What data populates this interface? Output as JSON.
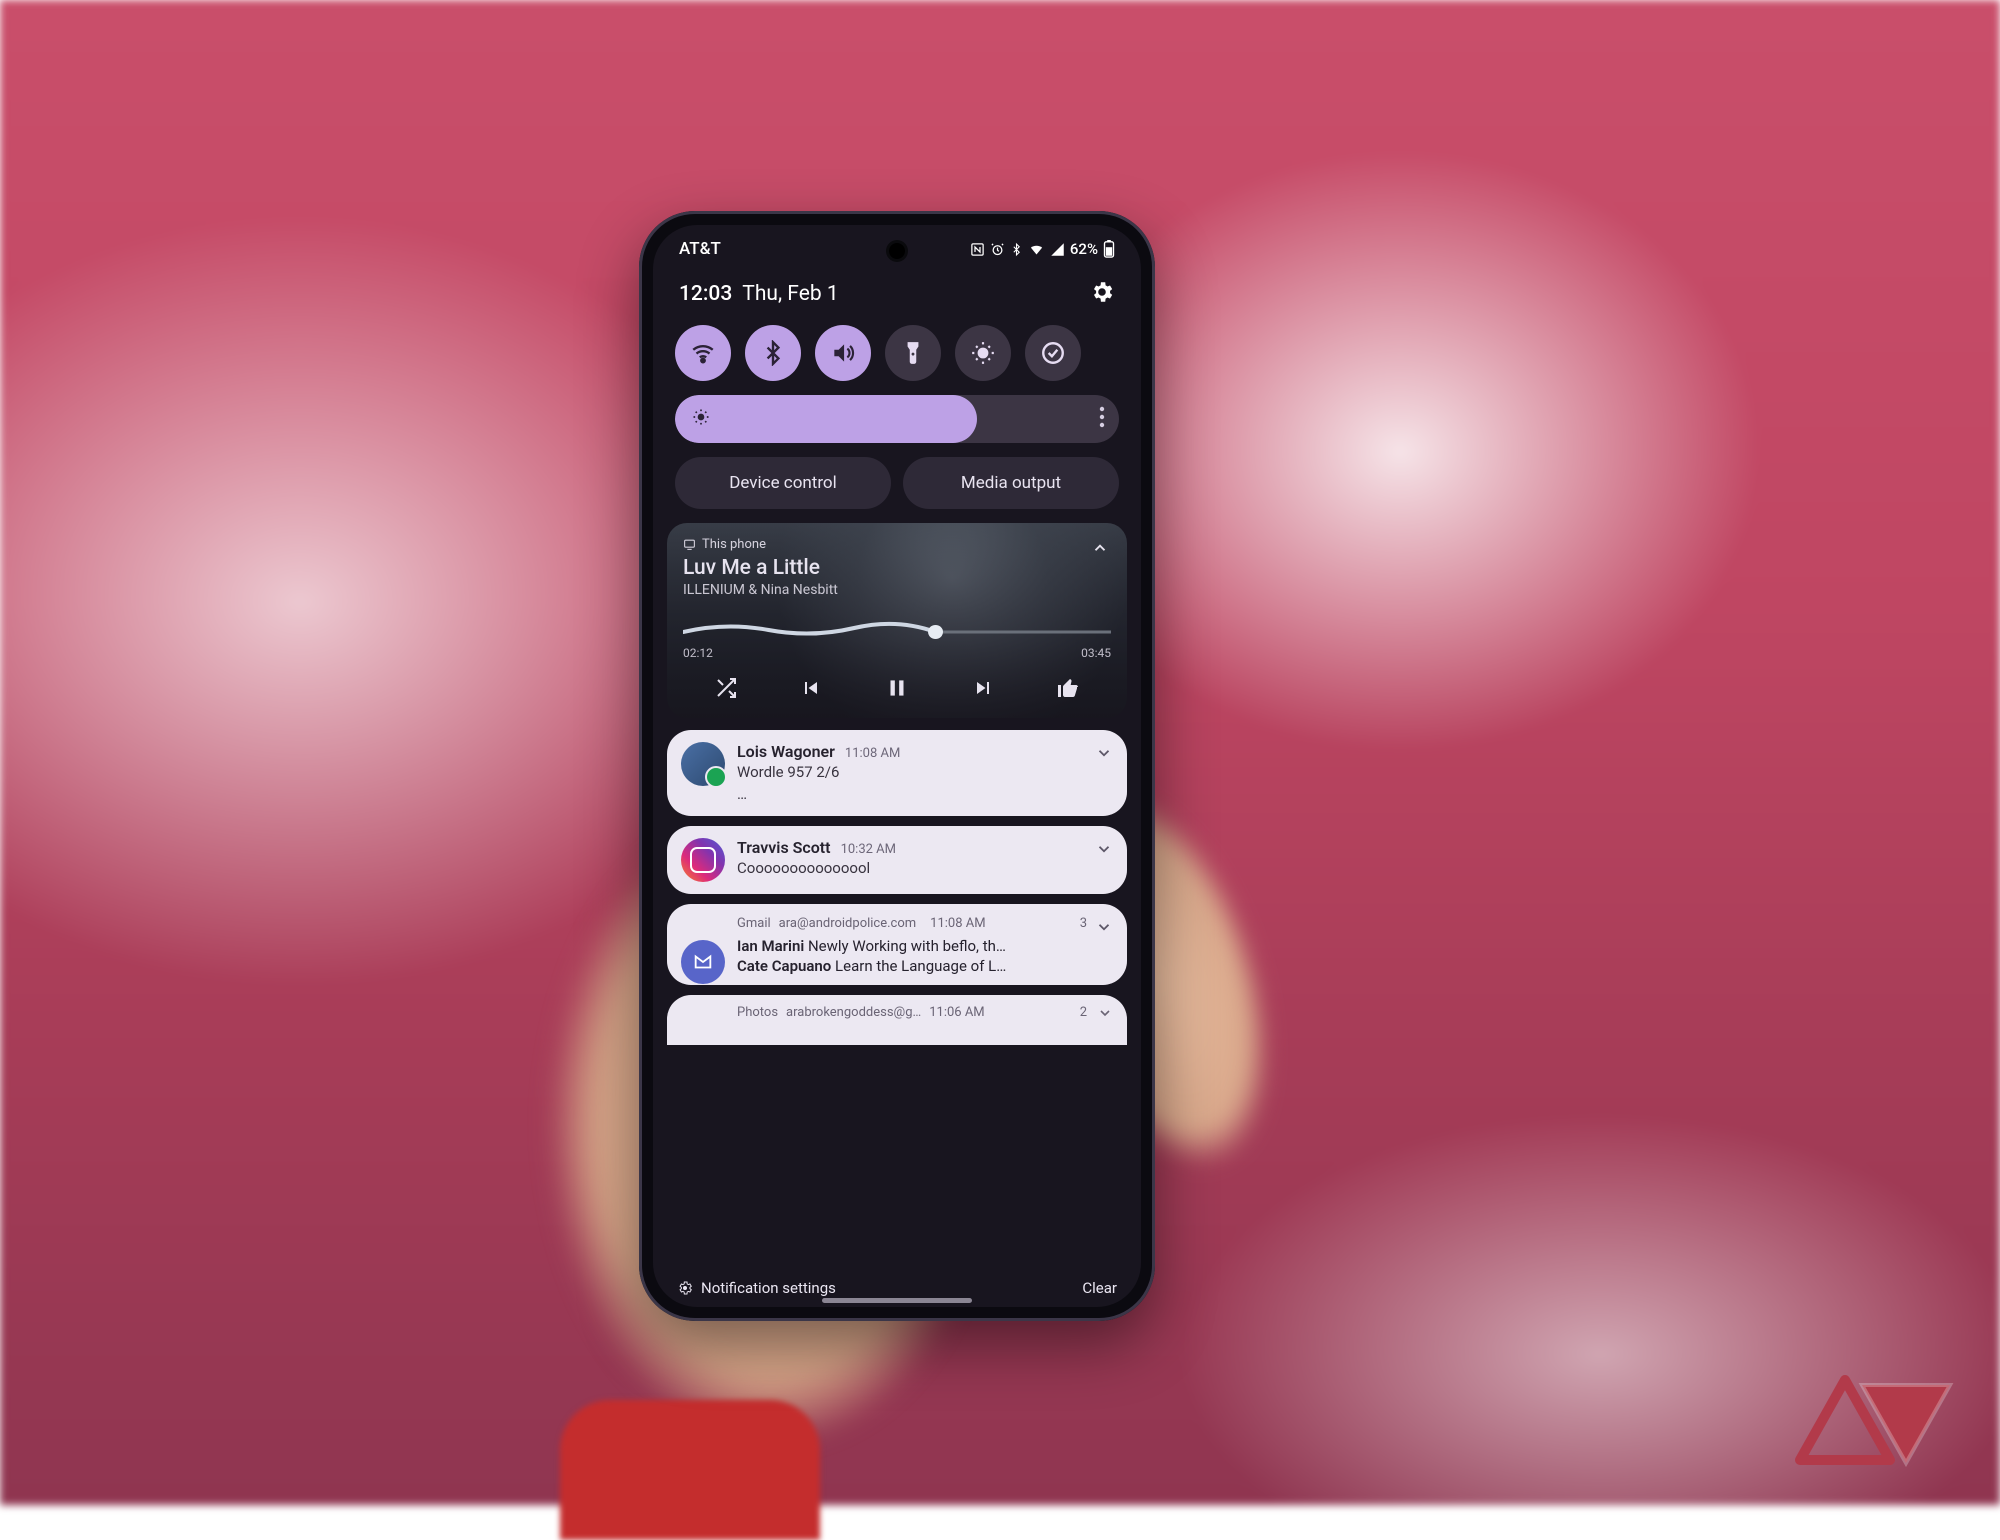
{
  "status": {
    "carrier": "AT&T",
    "battery": "62%"
  },
  "header": {
    "time": "12:03",
    "date": "Thu, Feb 1"
  },
  "toggles": {
    "wifi": "on",
    "bluetooth": "on",
    "sound": "on",
    "flashlight": "off",
    "dark": "off",
    "mode": "off"
  },
  "brightness_pct": 68,
  "chips": {
    "device_control": "Device control",
    "media_output": "Media output"
  },
  "media": {
    "source": "This phone",
    "title": "Luv Me a Little",
    "artist": "ILLENIUM & Nina Nesbitt",
    "elapsed": "02:12",
    "total": "03:45",
    "progress_pct": 59
  },
  "notifications": [
    {
      "type": "msg",
      "sender": "Lois Wagoner",
      "time": "11:08 AM",
      "body": "Wordle 957 2/6",
      "extra": "…"
    },
    {
      "type": "msg",
      "sender": "Travvis Scott",
      "time": "10:32 AM",
      "body": "Cooooooooooooool"
    },
    {
      "type": "group",
      "app": "Gmail",
      "account": "ara@androidpolice.com",
      "time": "11:08 AM",
      "count": "3",
      "lines": [
        {
          "from": "Ian Marini",
          "text": "Newly Working with beflo, th…"
        },
        {
          "from": "Cate Capuano",
          "text": "Learn the Language of L…"
        }
      ]
    }
  ],
  "peek": {
    "app": "Photos",
    "account": "arabrokengoddess@g…",
    "time": "11:06 AM",
    "count": "2"
  },
  "footer": {
    "settings": "Notification settings",
    "clear": "Clear"
  }
}
